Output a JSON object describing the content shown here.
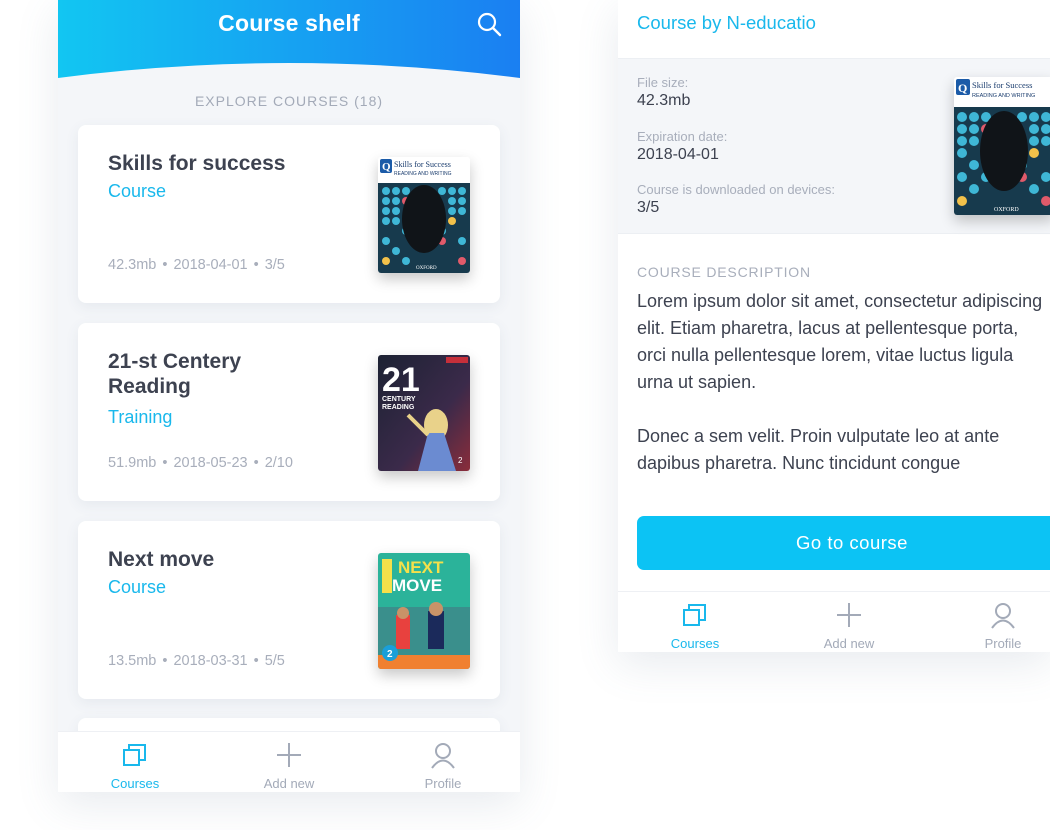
{
  "left": {
    "header": {
      "title": "Course shelf",
      "search_icon": "search-icon"
    },
    "section_label": "EXPLORE COURSES (18)",
    "courses": [
      {
        "title": "Skills for success",
        "type": "Course",
        "size": "42.3mb",
        "date": "2018-04-01",
        "devices": "3/5",
        "cover_icon": "book-cover-skills"
      },
      {
        "title": "21-st Centery Reading",
        "type": "Training",
        "size": "51.9mb",
        "date": "2018-05-23",
        "devices": "2/10",
        "cover_icon": "book-cover-21st-century"
      },
      {
        "title": "Next move",
        "type": "Course",
        "size": "13.5mb",
        "date": "2018-03-31",
        "devices": "5/5",
        "cover_icon": "book-cover-next-move"
      }
    ],
    "tabbar": [
      {
        "label": "Courses",
        "icon": "courses-icon",
        "active": true
      },
      {
        "label": "Add new",
        "icon": "plus-icon",
        "active": false
      },
      {
        "label": "Profile",
        "icon": "profile-icon",
        "active": false
      }
    ]
  },
  "right": {
    "author": "Course by N-educatio",
    "info": {
      "file_size_label": "File size:",
      "file_size": "42.3mb",
      "expiration_label": "Expiration date:",
      "expiration": "2018-04-01",
      "devices_label": "Course is downloaded on devices:",
      "devices": "3/5"
    },
    "description_label": "COURSE DESCRIPTION",
    "description_p1": "Lorem ipsum dolor sit amet, consectetur adipiscing elit. Etiam pharetra, lacus at pellentesque porta, orci nulla pellentesque lorem, vitae luctus ligula urna ut sapien.",
    "description_p2": "Donec a sem velit. Proin vulputate leo at ante dapibus pharetra. Nunc tincidunt congue",
    "go_button": "Go to course",
    "tabbar": [
      {
        "label": "Courses",
        "icon": "courses-icon",
        "active": true
      },
      {
        "label": "Add new",
        "icon": "plus-icon",
        "active": false
      },
      {
        "label": "Profile",
        "icon": "profile-icon",
        "active": false
      }
    ]
  },
  "colors": {
    "accent": "#19b8ec",
    "button": "#0cc3f4",
    "header_start": "#12c6f2",
    "header_end": "#1a7ff2"
  }
}
